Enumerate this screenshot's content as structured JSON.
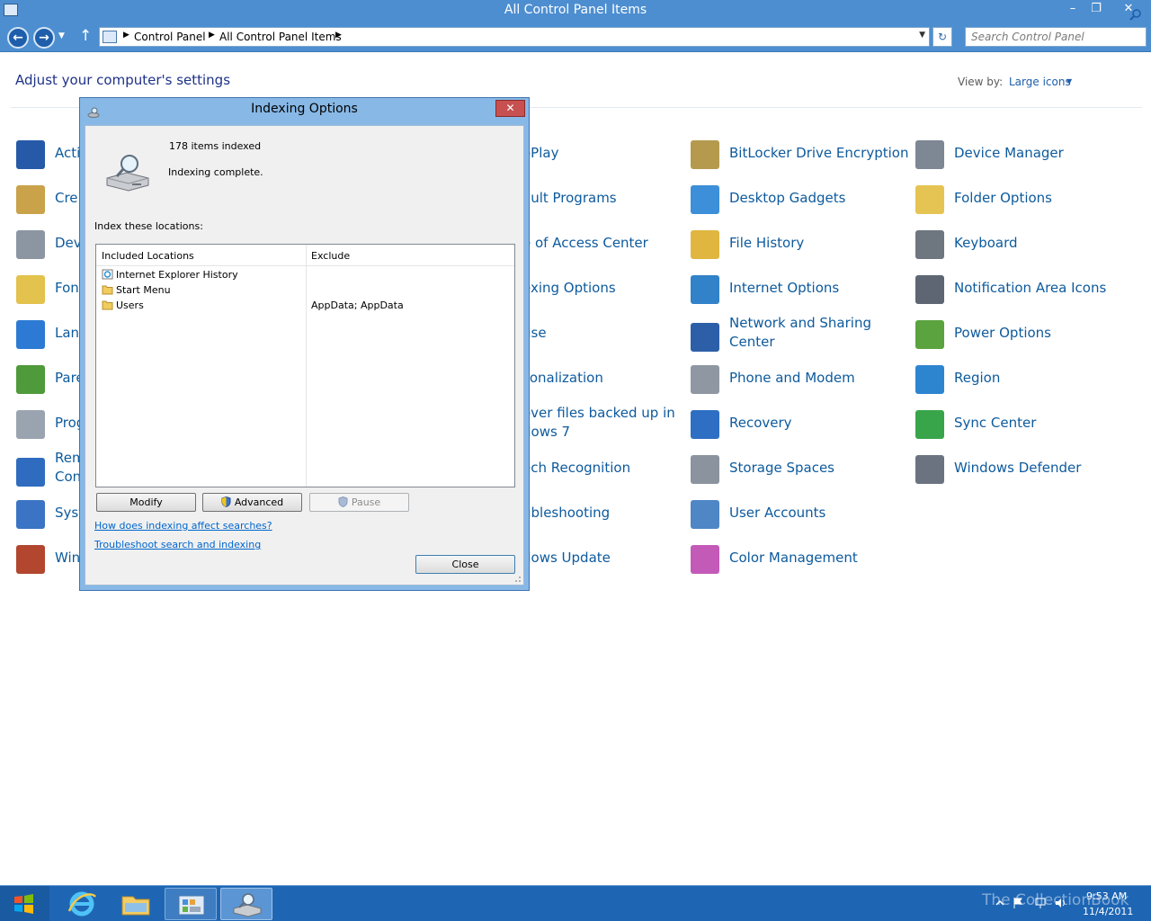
{
  "window": {
    "title": "All Control Panel Items",
    "breadcrumb": [
      "Control Panel",
      "All Control Panel Items"
    ],
    "search_placeholder": "Search Control Panel"
  },
  "control_panel": {
    "heading": "Adjust your computer's settings",
    "view_by_label": "View by:",
    "view_by_value": "Large icons",
    "items": [
      {
        "label": "Acti",
        "icon": "flag-icon"
      },
      {
        "label": "Cre",
        "icon": "credential-icon"
      },
      {
        "label": "Dev",
        "icon": "devices-printers-icon"
      },
      {
        "label": "Fon",
        "icon": "fonts-icon"
      },
      {
        "label": "Lan",
        "icon": "language-icon"
      },
      {
        "label": "Pare",
        "icon": "parental-icon"
      },
      {
        "label": "Prog",
        "icon": "programs-icon"
      },
      {
        "label": "Rem\nCon",
        "icon": "remoteapp-icon"
      },
      {
        "label": "Syst",
        "icon": "system-icon"
      },
      {
        "label": "Win",
        "icon": "firewall-icon"
      },
      {
        "label": "oPlay",
        "icon": ""
      },
      {
        "label": "ault Programs",
        "icon": ""
      },
      {
        "label": "e of Access Center",
        "icon": ""
      },
      {
        "label": "exing Options",
        "icon": ""
      },
      {
        "label": "use",
        "icon": ""
      },
      {
        "label": "sonalization",
        "icon": ""
      },
      {
        "label": "over files backed up in\ndows 7",
        "icon": ""
      },
      {
        "label": "ech Recognition",
        "icon": ""
      },
      {
        "label": "ubleshooting",
        "icon": ""
      },
      {
        "label": "dows Update",
        "icon": ""
      },
      {
        "label": "BitLocker Drive Encryption",
        "icon": "bitlocker-icon"
      },
      {
        "label": "Desktop Gadgets",
        "icon": "gadgets-icon"
      },
      {
        "label": "File History",
        "icon": "file-history-icon"
      },
      {
        "label": "Internet Options",
        "icon": "internet-options-icon"
      },
      {
        "label": "Network and Sharing\nCenter",
        "icon": "network-icon"
      },
      {
        "label": "Phone and Modem",
        "icon": "phone-icon"
      },
      {
        "label": "Recovery",
        "icon": "recovery-icon"
      },
      {
        "label": "Storage Spaces",
        "icon": "storage-icon"
      },
      {
        "label": "User Accounts",
        "icon": "user-accounts-icon"
      },
      {
        "label": "Color Management",
        "icon": "color-management-icon"
      },
      {
        "label": "Device Manager",
        "icon": "device-manager-icon"
      },
      {
        "label": "Folder Options",
        "icon": "folder-options-icon"
      },
      {
        "label": "Keyboard",
        "icon": "keyboard-icon"
      },
      {
        "label": "Notification Area Icons",
        "icon": "notification-icon"
      },
      {
        "label": "Power Options",
        "icon": "power-icon"
      },
      {
        "label": "Region",
        "icon": "region-icon"
      },
      {
        "label": "Sync Center",
        "icon": "sync-icon"
      },
      {
        "label": "Windows Defender",
        "icon": "defender-icon"
      }
    ]
  },
  "dialog": {
    "title": "Indexing Options",
    "items_indexed": "178 items indexed",
    "status": "Indexing complete.",
    "index_label": "Index these locations:",
    "columns": [
      "Included Locations",
      "Exclude"
    ],
    "locations": [
      {
        "name": "Internet Explorer History",
        "exclude": "",
        "icon": "ie-history-icon"
      },
      {
        "name": "Start Menu",
        "exclude": "",
        "icon": "folder-icon"
      },
      {
        "name": "Users",
        "exclude": "AppData; AppData",
        "icon": "folder-icon"
      }
    ],
    "buttons": {
      "modify": "Modify",
      "advanced": "Advanced",
      "pause": "Pause",
      "close": "Close"
    },
    "links": {
      "how_affect": "How does indexing affect searches?",
      "troubleshoot": "Troubleshoot search and indexing"
    }
  },
  "taskbar": {
    "watermark": "The CollectionBook",
    "time": "9:53 AM",
    "date": "11/4/2011"
  },
  "colors": {
    "titlebar": "#4d8ed0",
    "link": "#0d5a9d",
    "taskbar": "#1e66b4"
  }
}
